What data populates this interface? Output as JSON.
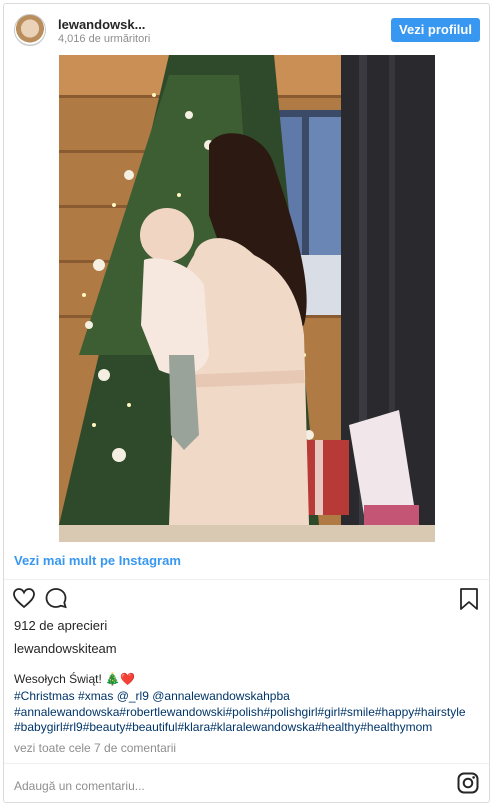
{
  "header": {
    "username": "lewandowsk...",
    "followers": "4,016 de urmăritori",
    "profile_button": "Vezi profilul"
  },
  "post": {
    "image_alt": "Woman holding baby by Christmas tree",
    "view_more_link": "Vezi mai mult pe Instagram",
    "likes": "912 de aprecieri",
    "account": "lewandowskiteam",
    "caption": "Wesołych Świąt! 🎄❤️",
    "hashtag_lines": [
      "#Christmas #xmas @_rl9 @annalewandowskahpba",
      "#annalewandowska#robertlewandowski#polish#polishgirl#girl#smile#happy#hairstyle",
      "#babygirl#rl9#beauty#beautiful#klara#klaralewandowska#healthy#healthymom"
    ],
    "comments_link": "vezi toate cele 7 de comentarii",
    "comment_placeholder": "Adaugă un comentariu..."
  },
  "icons": {
    "like": "heart-icon",
    "comment": "comment-icon",
    "save": "bookmark-icon",
    "instagram": "instagram-icon"
  },
  "colors": {
    "accent": "#3897f0",
    "hashtag": "#003569",
    "muted": "#8e8e8e"
  }
}
